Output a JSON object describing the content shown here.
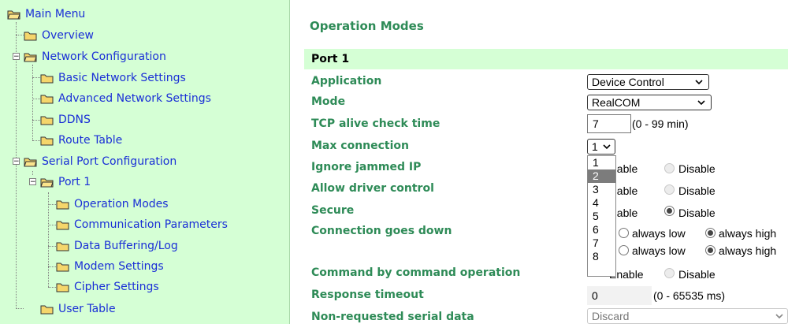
{
  "tree": {
    "main_menu": "Main Menu",
    "overview": "Overview",
    "network_configuration": "Network Configuration",
    "basic_network_settings": "Basic Network Settings",
    "advanced_network_settings": "Advanced Network Settings",
    "ddns": "DDNS",
    "route_table": "Route Table",
    "serial_port_configuration": "Serial Port Configuration",
    "port1": "Port 1",
    "operation_modes": "Operation Modes",
    "communication_parameters": "Communication Parameters",
    "data_buffering_log": "Data Buffering/Log",
    "modem_settings": "Modem Settings",
    "cipher_settings": "Cipher Settings",
    "user_table": "User Table"
  },
  "page": {
    "title": "Operation Modes",
    "port_header": "Port 1"
  },
  "labels": {
    "application": "Application",
    "mode": "Mode",
    "tcp_alive": "TCP alive check time",
    "max_connection": "Max connection",
    "ignore_jammed_ip": "Ignore jammed IP",
    "allow_driver_control": "Allow driver control",
    "secure": "Secure",
    "connection_goes_down": "Connection goes down",
    "command_by_command": "Command by command operation",
    "response_timeout": "Response timeout",
    "non_requested_serial": "Non-requested serial data"
  },
  "values": {
    "application": "Device Control",
    "mode": "RealCOM",
    "tcp_alive": "7",
    "tcp_alive_hint": "(0 - 99 min)",
    "max_connection": "1",
    "response_timeout": "0",
    "response_timeout_hint": "(0 - 65535 ms)",
    "non_requested_serial": "Discard"
  },
  "radios": {
    "enable_partial": "nable",
    "enable_partial_cmd": "Enable",
    "disable": "Disable",
    "always_low": "always low",
    "always_high": "always high"
  },
  "dropdown_options": [
    "1",
    "2",
    "3",
    "4",
    "5",
    "6",
    "7",
    "8"
  ],
  "colors": {
    "tree_bg": "#d5ffd5",
    "label_green": "#2e8b57",
    "link_blue": "#1a2fd6",
    "highlight": "#7c7c7c"
  }
}
